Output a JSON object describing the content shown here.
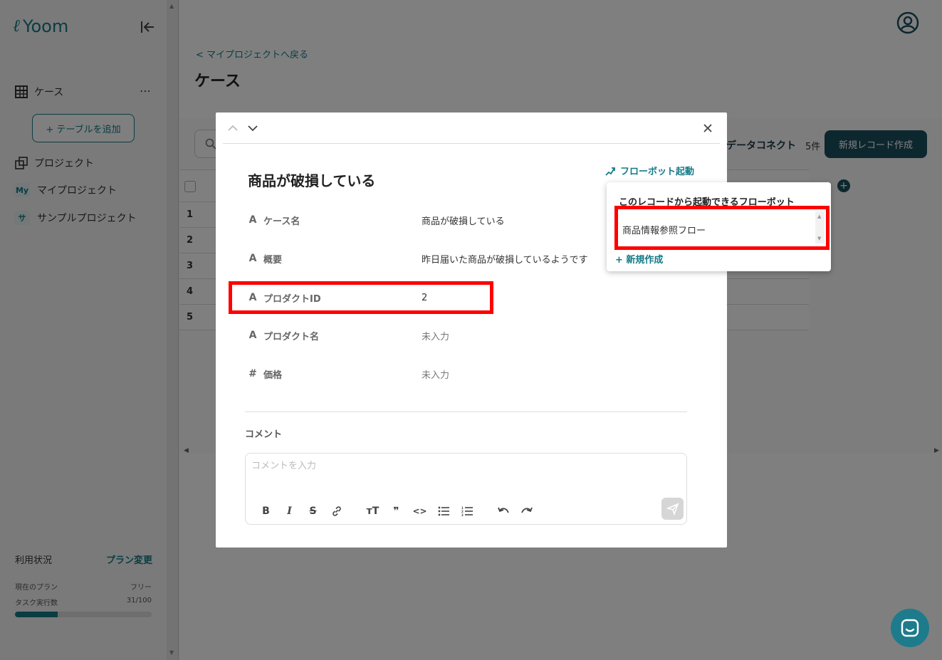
{
  "app": {
    "logo": "Yoom"
  },
  "sidebar": {
    "table_name": "ケース",
    "add_table_label": "+ テーブルを追加",
    "projects_label": "プロジェクト",
    "projects": [
      {
        "badge": "My",
        "name": "マイプロジェクト"
      },
      {
        "badge": "サ",
        "name": "サンプルプロジェクト"
      }
    ],
    "usage": {
      "title": "利用状況",
      "plan_change": "プラン変更",
      "current_plan_label": "現在のプラン",
      "current_plan_value": "フリー",
      "task_label": "タスク実行数",
      "task_value": "31/100",
      "task_fraction": 0.31
    }
  },
  "header": {
    "back_link": "< マイプロジェクトへ戻る",
    "title": "ケース"
  },
  "toolbar": {
    "data_connect": "データコネクト",
    "count": "5件",
    "new_record": "新規レコード作成"
  },
  "grid": {
    "rows": [
      "1",
      "2",
      "3",
      "4",
      "5"
    ]
  },
  "modal": {
    "record_title": "商品が破損している",
    "flowbot_label": "フローボット起動",
    "fields": [
      {
        "type_icon": "A",
        "name": "ケース名",
        "value": "商品が破損している",
        "empty": false
      },
      {
        "type_icon": "A",
        "name": "概要",
        "value": "昨日届いた商品が破損しているようです",
        "empty": false
      },
      {
        "type_icon": "A",
        "name": "プロダクトID",
        "value": "2",
        "empty": false
      },
      {
        "type_icon": "A",
        "name": "プロダクト名",
        "value": "未入力",
        "empty": true
      },
      {
        "type_icon": "#",
        "name": "価格",
        "value": "未入力",
        "empty": true
      }
    ],
    "comment_label": "コメント",
    "comment_placeholder": "コメントを入力"
  },
  "popup": {
    "title": "このレコードから起動できるフローボット",
    "items": [
      "商品情報参照フロー"
    ],
    "new_label": "+ 新規作成"
  },
  "colors": {
    "accent": "#147a87",
    "dark_button": "#1b4f5f",
    "highlight": "#ff0000",
    "overlay": "rgba(0,0,0,0.5)"
  }
}
